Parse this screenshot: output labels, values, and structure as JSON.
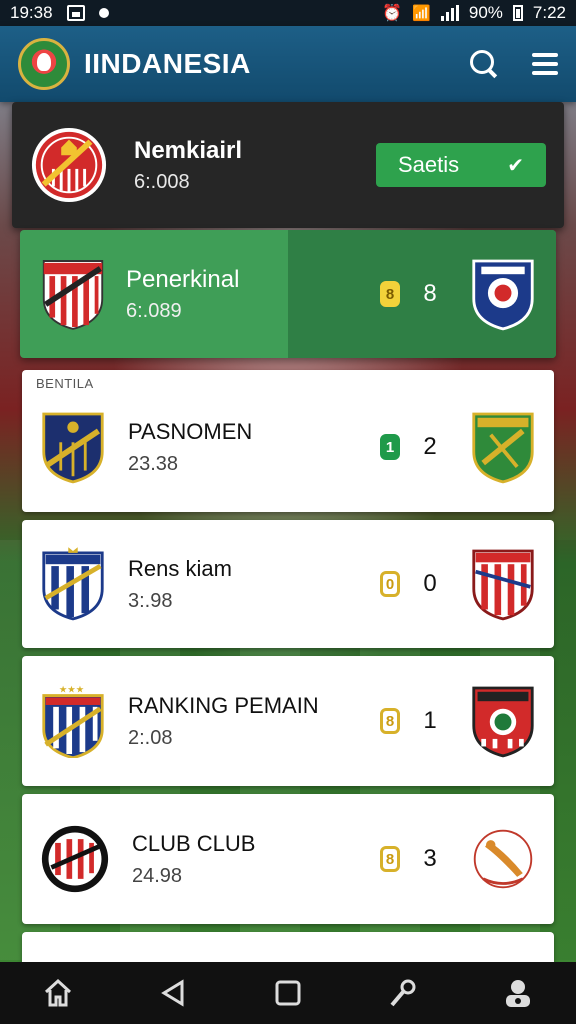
{
  "status_bar": {
    "time_left": "19:38",
    "battery": "90%",
    "time_right": "7:22"
  },
  "header": {
    "title": "IINDANESIA",
    "icons": [
      "search-icon",
      "menu-icon"
    ]
  },
  "featured": {
    "team": "Nemkiairl",
    "time": "6:.008",
    "button_label": "Saetis"
  },
  "highlight": {
    "team": "Penerkinal",
    "time": "6:.089",
    "pill": "8",
    "score": "8"
  },
  "section_label": "BENTILA",
  "matches": [
    {
      "team": "PASNOMEN",
      "time": "23.38",
      "pill": "1",
      "score": "2",
      "pill_style": "green"
    },
    {
      "team": "Rens kiam",
      "time": "3:.98",
      "pill": "0",
      "score": "0",
      "pill_style": "gold"
    },
    {
      "team": "RANKING PEMAIN",
      "time": "2:.08",
      "pill": "8",
      "score": "1",
      "pill_style": "gold"
    },
    {
      "team": "CLUB CLUB",
      "time": "24.98",
      "pill": "8",
      "score": "3",
      "pill_style": "gold"
    }
  ],
  "colors": {
    "header": "#124a6d",
    "accent_green": "#2ea24d",
    "pill_gold": "#d7b12a"
  },
  "nav": [
    "home-icon",
    "back-icon",
    "recents-icon",
    "search-nav-icon",
    "account-icon"
  ]
}
